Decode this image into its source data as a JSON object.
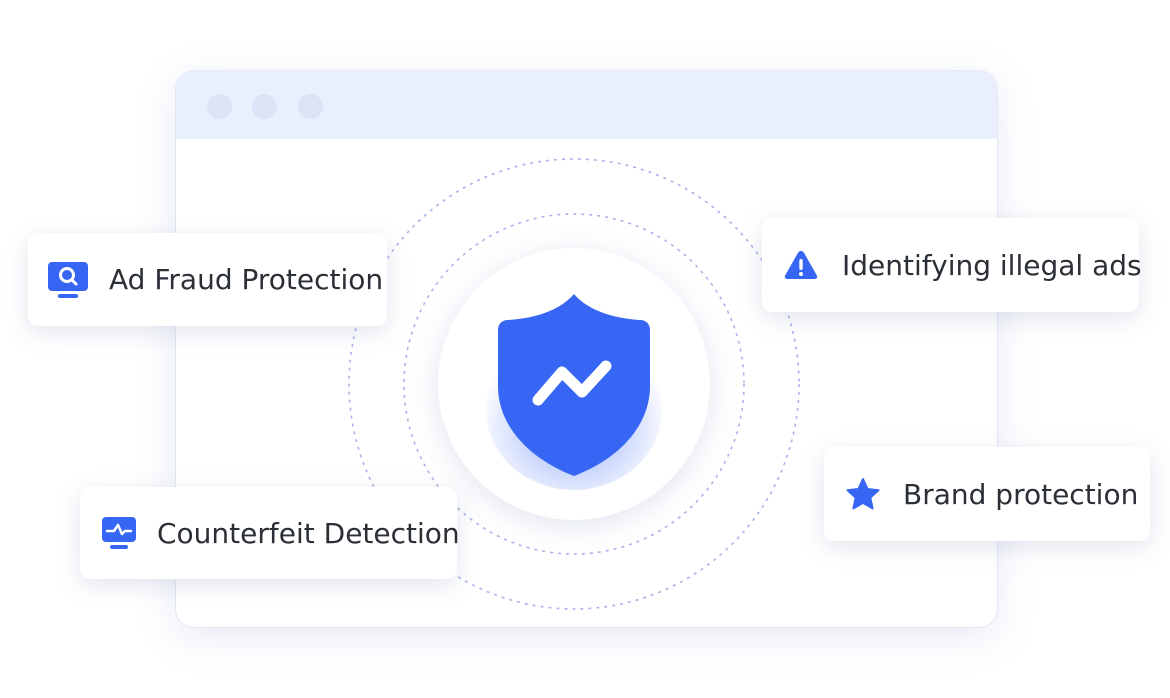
{
  "colors": {
    "accent": "#3766f4",
    "window_bar": "#e9effd",
    "ring": "#aab4e8",
    "text": "#2b2f36"
  },
  "window": {
    "controls": [
      "window-dot",
      "window-dot",
      "window-dot"
    ]
  },
  "center": {
    "icon": "shield-trend-icon"
  },
  "features": {
    "ad_fraud": {
      "label": "Ad Fraud Protection",
      "icon": "monitor-search-icon"
    },
    "illegal_ads": {
      "label": "Identifying illegal ads",
      "icon": "warning-icon"
    },
    "counterfeit": {
      "label": "Counterfeit Detection",
      "icon": "monitor-pulse-icon"
    },
    "brand": {
      "label": "Brand protection",
      "icon": "star-icon"
    }
  }
}
